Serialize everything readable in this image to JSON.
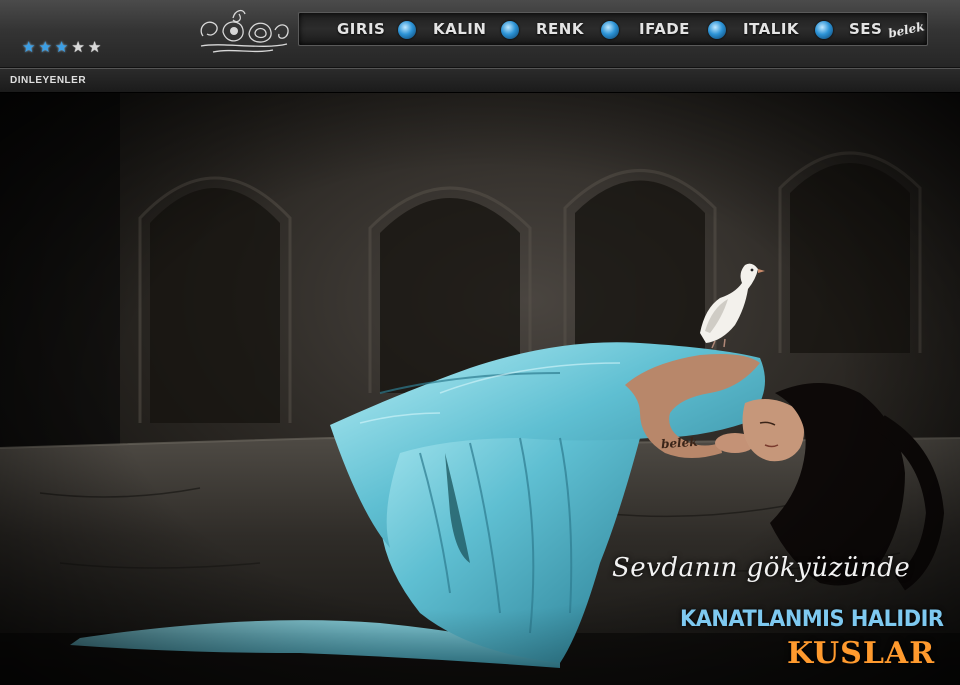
{
  "rating": {
    "filled": 3,
    "total": 5
  },
  "nav": {
    "items": [
      "GIRIS",
      "KALIN",
      "RENK",
      "IFADE",
      "ITALIK",
      "SES"
    ],
    "signature": "belek"
  },
  "subbar": {
    "label": "DINLEYENLER"
  },
  "artwork": {
    "caption_script": "Sevdanın gökyüzünde",
    "caption_line2": "KANATLANMIS HALIDIR",
    "caption_line3": "KUSLAR",
    "arm_signature": "belek"
  },
  "colors": {
    "star_filled": "#3a9fe6",
    "dot_blue": "#2c93d6",
    "caption_blue": "#7ec9f0",
    "caption_orange": "#ff9a2e",
    "dress": "#6fc7d6"
  }
}
